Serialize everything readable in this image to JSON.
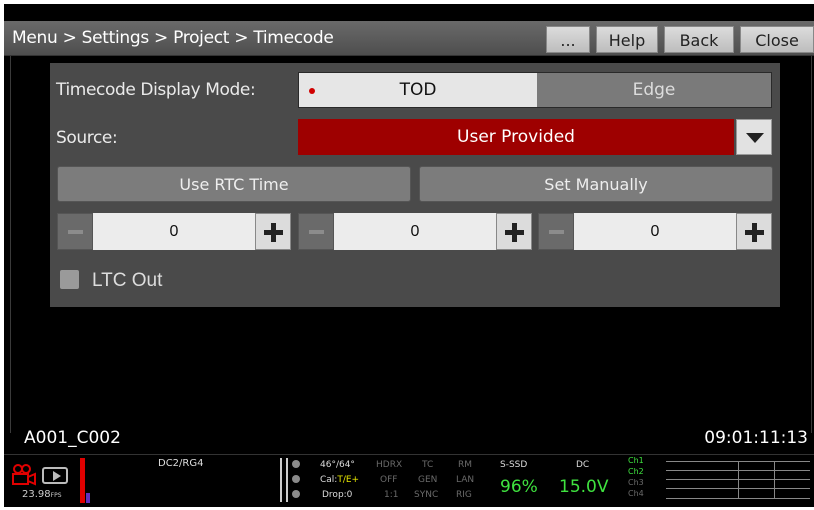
{
  "header": {
    "breadcrumb": "Menu > Settings > Project > Timecode",
    "buttons": {
      "more": "...",
      "help": "Help",
      "back": "Back",
      "close": "Close"
    }
  },
  "timecode": {
    "display_mode_label": "Timecode Display Mode:",
    "display_mode_options": [
      "TOD",
      "Edge"
    ],
    "display_mode_selected": "TOD",
    "source_label": "Source:",
    "source_value": "User Provided",
    "use_rtc_label": "Use RTC Time",
    "set_manually_label": "Set Manually",
    "steppers": [
      {
        "value": "0"
      },
      {
        "value": "0"
      },
      {
        "value": "0"
      }
    ],
    "ltc_out_label": "LTC Out",
    "ltc_out_checked": false
  },
  "footer": {
    "clip_name": "A001_C002",
    "timecode": "09:01:11:13"
  },
  "status_bar": {
    "fps": "23.98",
    "fps_unit": "FPS",
    "lut": "DC2/RG4",
    "temp": "46°/64°",
    "cal_prefix": "Cal:",
    "cal_value": "T/E+",
    "drop": "Drop:0",
    "indicators": [
      [
        "HDRX",
        "OFF",
        "1:1"
      ],
      [
        "TC",
        "GEN",
        "SYNC"
      ],
      [
        "RM",
        "LAN",
        "RIG"
      ]
    ],
    "media_label": "S-SSD",
    "media_value": "96%",
    "power_label": "DC",
    "power_value": "15.0V",
    "channels": [
      "Ch1",
      "Ch2",
      "Ch3",
      "Ch4"
    ],
    "colors": {
      "accent_red": "#9e0000",
      "green": "#3fe23f",
      "yellow": "#e6e600"
    }
  }
}
